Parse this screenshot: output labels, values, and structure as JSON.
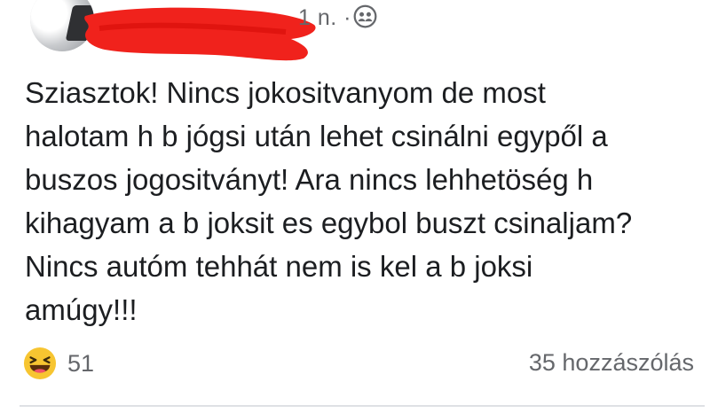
{
  "header": {
    "time": "1 n.",
    "separator": "·",
    "audience_icon": "friends-icon",
    "redaction_color": "#f0221c"
  },
  "post": {
    "lines": [
      "Sziasztok! Nincs jokositvanyom de most",
      "halotam h b jógsi után lehet csinálni egypől a",
      "buszos jogositványt! Ara nincs lehhetöség h",
      "kihagyam a b joksit es egybol buszt csinaljam?",
      "Nincs autóm tehhát nem is kel a b joksi",
      "amúgy!!!"
    ]
  },
  "footer": {
    "reaction_icon": "haha-reaction-icon",
    "reaction_count": "51",
    "comments_label": "35 hozzászólás"
  },
  "colors": {
    "text": "#1c1e21",
    "meta": "#65676b",
    "divider": "#dfe1e5",
    "haha_yellow": "#f7c531"
  }
}
